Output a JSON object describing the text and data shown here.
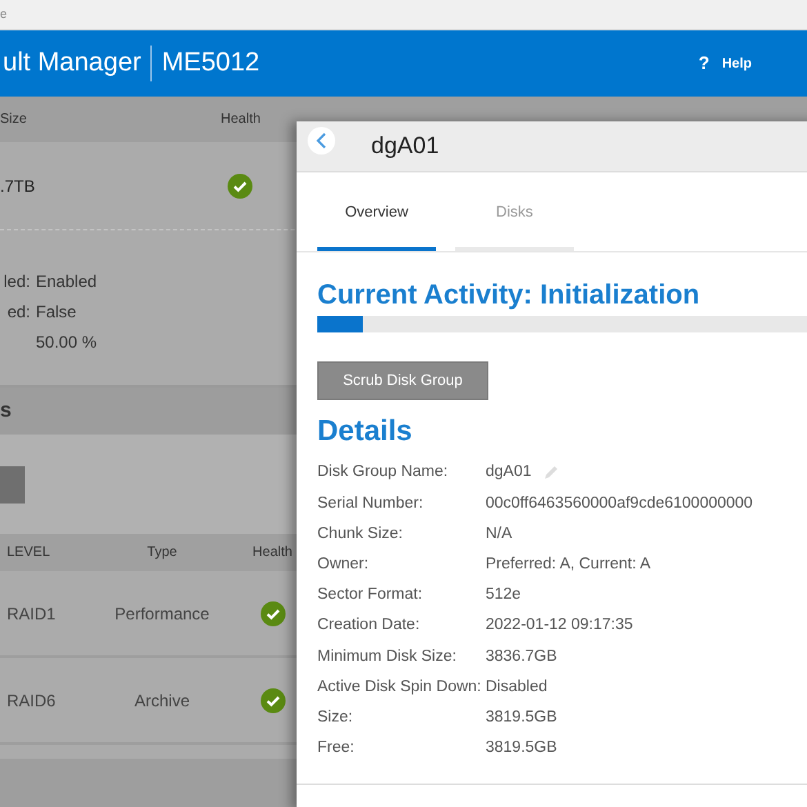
{
  "browser_tab": {
    "title": "e"
  },
  "header": {
    "title": "ult Manager",
    "system": "ME5012",
    "help_icon": "?",
    "help": "Help"
  },
  "background": {
    "columns": [
      "Size",
      "Health"
    ],
    "summary_row": {
      "size": ".7TB",
      "healthy": true
    },
    "properties": [
      {
        "label": "led:",
        "value": "Enabled"
      },
      {
        "label": "ed:",
        "value": "False"
      },
      {
        "value": "50.00 %"
      }
    ],
    "section_title": "s",
    "table": {
      "columns": [
        "LEVEL",
        "Type",
        "Health"
      ],
      "rows": [
        {
          "level": "RAID1",
          "type": "Performance",
          "healthy": true
        },
        {
          "level": "RAID6",
          "type": "Archive",
          "healthy": true
        }
      ]
    }
  },
  "panel": {
    "title": "dgA01",
    "tabs": [
      {
        "label": "Overview",
        "selected": true
      },
      {
        "label": "Disks",
        "selected": false
      }
    ],
    "activity": {
      "title": "Current Activity: Initialization",
      "level": 0.088
    },
    "scrub_button": "Scrub Disk Group",
    "details_title": "Details",
    "details": [
      {
        "label": "Disk Group Name:",
        "value": "dgA01",
        "editable": true
      },
      {
        "label": "Serial Number:",
        "value": "00c0ff6463560000af9cde6100000000",
        "editable": false
      },
      {
        "label": "Chunk Size:",
        "value": "N/A",
        "editable": false
      },
      {
        "label": "Owner:",
        "value": "Preferred: A, Current: A",
        "editable": false
      },
      {
        "label": "Sector Format:",
        "value": "512e",
        "editable": false
      },
      {
        "label": "Creation Date:",
        "value": "2022-01-12 09:17:35",
        "editable": false
      },
      {
        "label": "Minimum Disk Size:",
        "value": "3836.7GB",
        "editable": false
      },
      {
        "label": "Active Disk Spin Down:",
        "value": "Disabled",
        "editable": false
      },
      {
        "label": "Size:",
        "value": "3819.5GB",
        "editable": false
      },
      {
        "label": "Free:",
        "value": "3819.5GB",
        "editable": false
      }
    ]
  }
}
